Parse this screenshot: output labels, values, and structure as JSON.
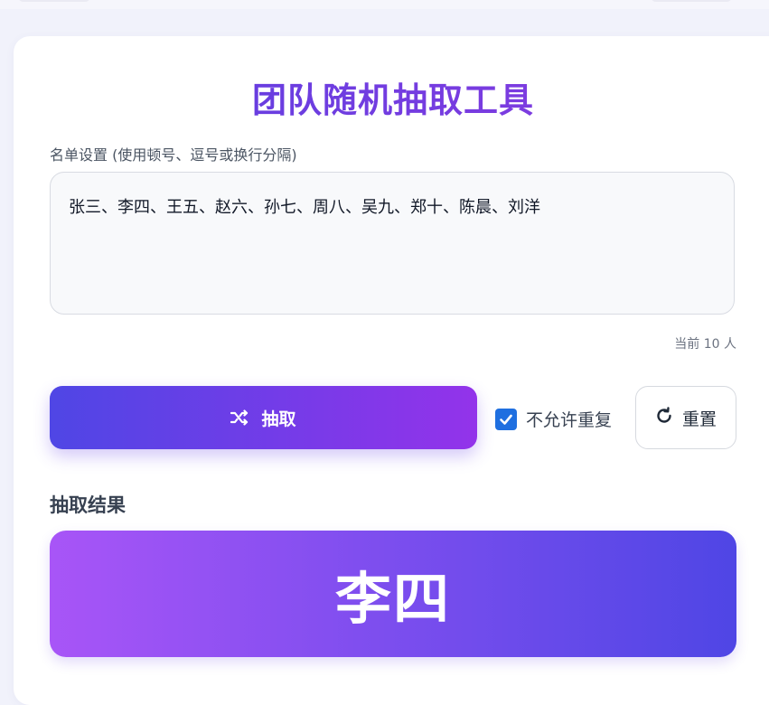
{
  "app": {
    "title": "团队随机抽取工具"
  },
  "names_field": {
    "label": "名单设置 (使用顿号、逗号或换行分隔)",
    "value": "张三、李四、王五、赵六、孙七、周八、吴九、郑十、陈晨、刘洋"
  },
  "count_text": "当前 10 人",
  "controls": {
    "draw_label": "抽取",
    "draw_icon": "shuffle-icon",
    "no_repeat_label": "不允许重复",
    "no_repeat_checked": true,
    "reset_label": "重置",
    "reset_icon": "refresh-icon"
  },
  "result": {
    "heading": "抽取结果",
    "name": "李四"
  },
  "colors": {
    "title_start": "#5b3ee0",
    "title_end": "#8a3be0",
    "button_start": "#4f46e5",
    "button_end": "#9333ea",
    "result_start": "#a855f7",
    "result_end": "#4f46e5",
    "checkbox": "#1f6fe0"
  }
}
